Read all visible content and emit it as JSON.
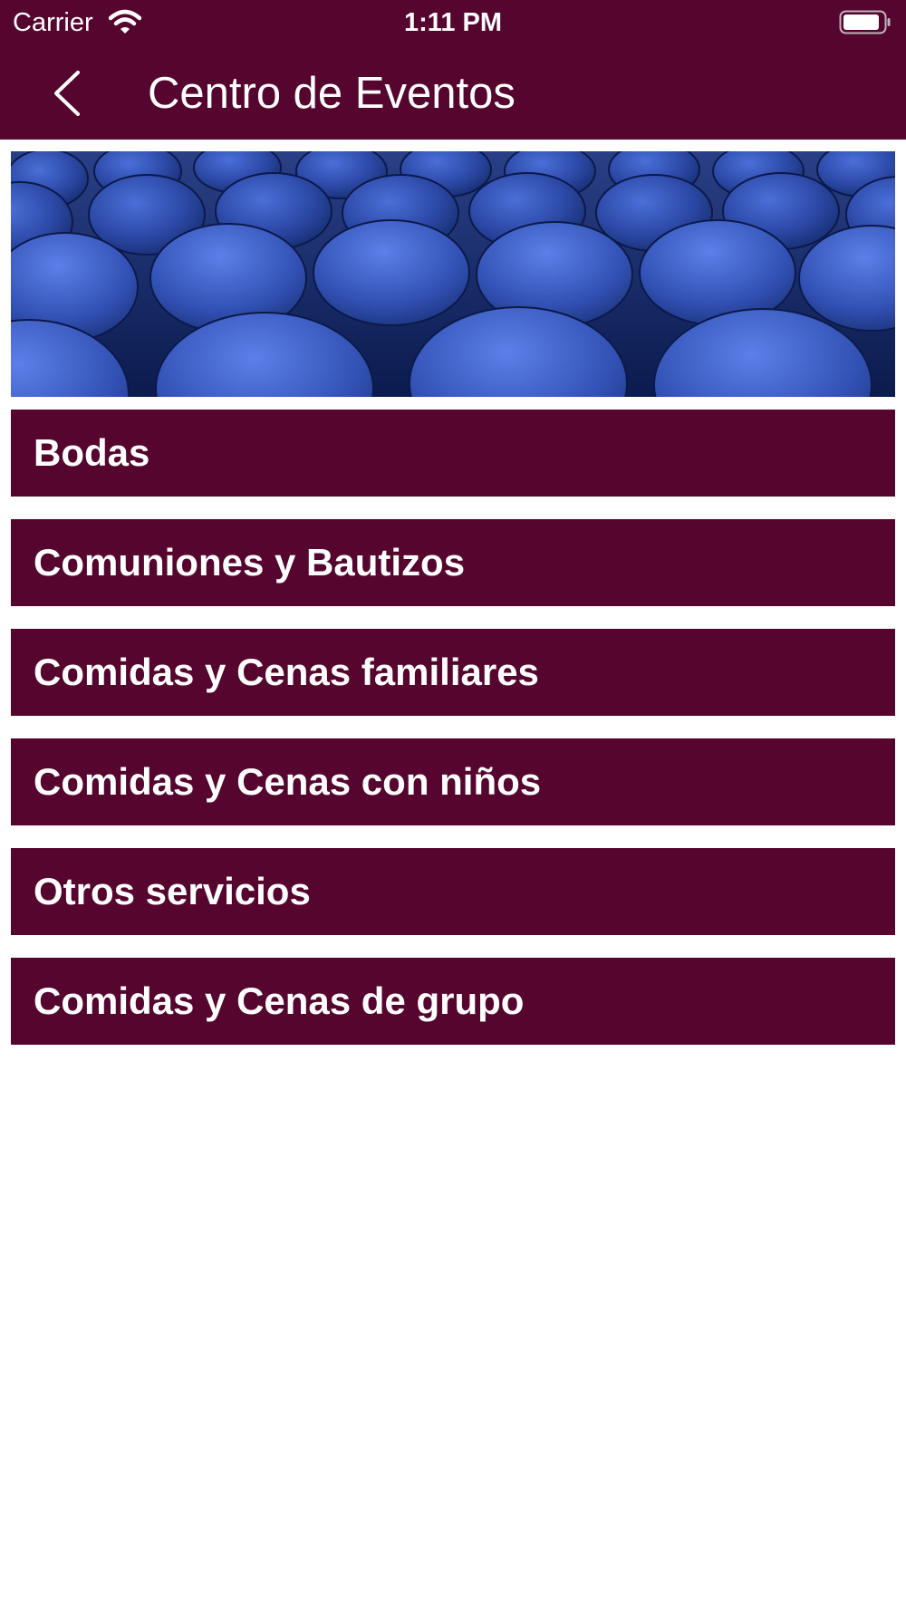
{
  "status_bar": {
    "carrier": "Carrier",
    "time": "1:11 PM",
    "wifi_icon": "wifi-icon",
    "battery_icon": "battery-icon"
  },
  "nav_bar": {
    "back_icon": "chevron-left-icon",
    "title": "Centro de Eventos"
  },
  "hero": {
    "image": "blue-auditorium-seats-photo"
  },
  "menu": {
    "items": [
      {
        "label": "Bodas"
      },
      {
        "label": "Comuniones y Bautizos"
      },
      {
        "label": "Comidas y Cenas familiares"
      },
      {
        "label": "Comidas y Cenas con niños"
      },
      {
        "label": "Otros servicios"
      },
      {
        "label": "Comidas y Cenas de grupo"
      }
    ]
  },
  "colors": {
    "brand": "#55052e",
    "text_on_brand": "#ffffff",
    "background": "#ffffff"
  }
}
